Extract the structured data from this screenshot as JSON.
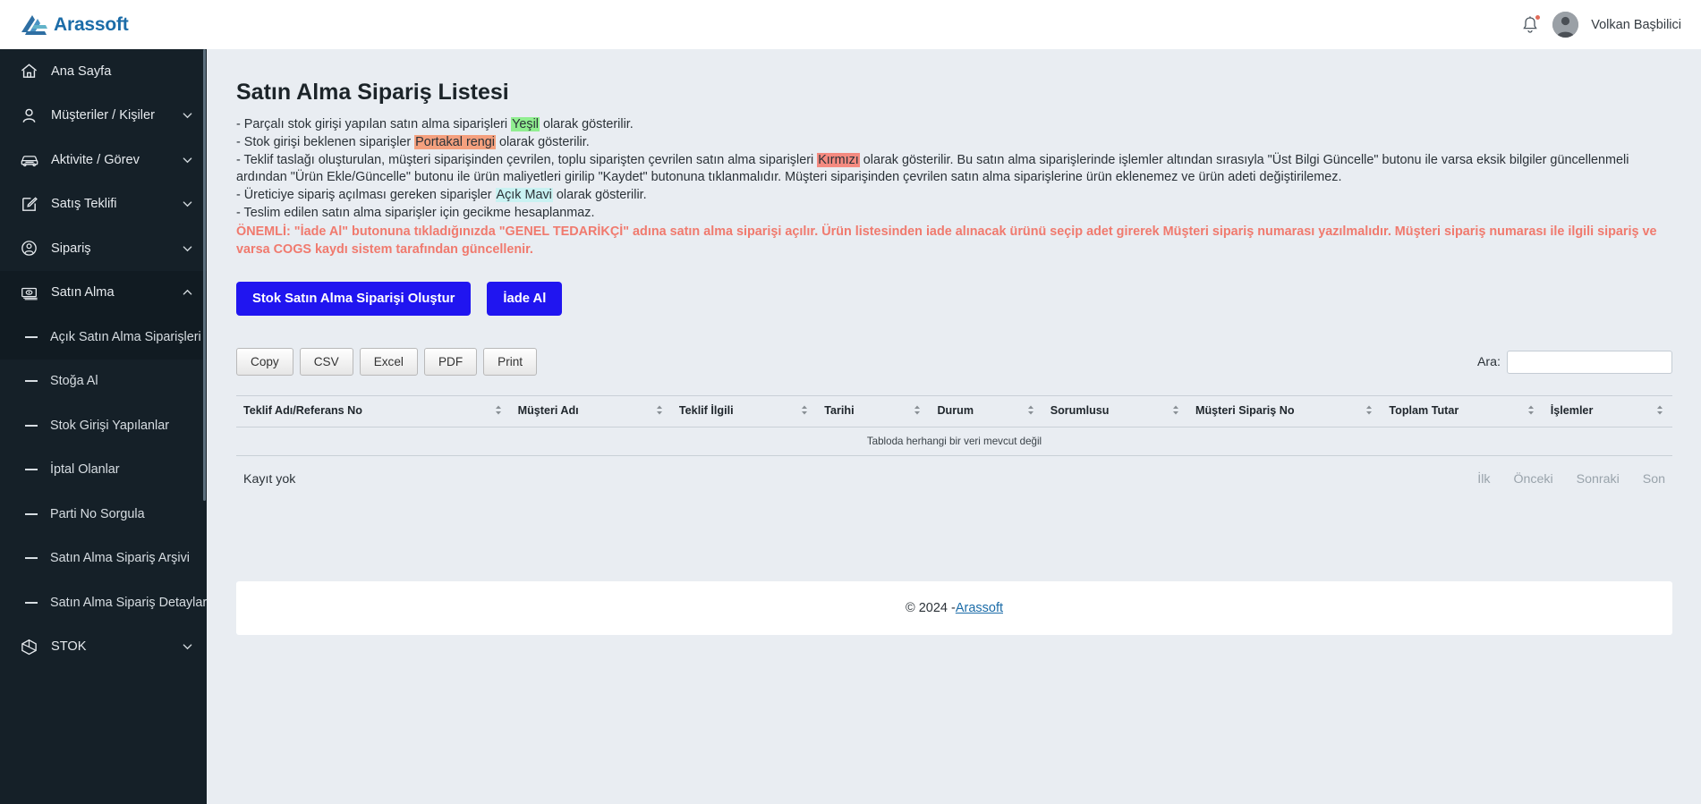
{
  "topbar": {
    "brand": "Arassoft",
    "user_name": "Volkan Başbilici",
    "bell_icon": "notification-bell-icon",
    "avatar_icon": "user-avatar-icon"
  },
  "sidebar": {
    "items": [
      {
        "label": "Ana Sayfa",
        "icon": "home-icon",
        "expandable": false,
        "active": false
      },
      {
        "label": "Müşteriler / Kişiler",
        "icon": "user-icon",
        "expandable": true,
        "active": false
      },
      {
        "label": "Aktivite / Görev",
        "icon": "car-icon",
        "expandable": true,
        "active": false
      },
      {
        "label": "Satış Teklifi",
        "icon": "edit-document-icon",
        "expandable": true,
        "active": false
      },
      {
        "label": "Sipariş",
        "icon": "user-circle-icon",
        "expandable": true,
        "active": false
      },
      {
        "label": "Satın Alma",
        "icon": "money-icon",
        "expandable": true,
        "active": true
      }
    ],
    "subitems": [
      {
        "label": "Açık Satın Alma Siparişleri",
        "active": true
      },
      {
        "label": "Stoğa Al",
        "active": false
      },
      {
        "label": "Stok Girişi Yapılanlar",
        "active": false
      },
      {
        "label": "İptal Olanlar",
        "active": false
      },
      {
        "label": "Parti No Sorgula",
        "active": false
      },
      {
        "label": "Satın Alma Sipariş Arşivi",
        "active": false
      },
      {
        "label": "Satın Alma Sipariş Detayları",
        "active": false
      }
    ],
    "bottom_items": [
      {
        "label": "STOK",
        "icon": "cube-icon",
        "expandable": true,
        "active": false
      }
    ]
  },
  "page": {
    "title": "Satın Alma Sipariş Listesi",
    "lines": {
      "l1_a": "- Parçalı stok girişi yapılan satın alma siparişleri ",
      "l1_hl": "Yeşil",
      "l1_b": " olarak gösterilir.",
      "l2_a": "- Stok girişi beklenen siparişler ",
      "l2_hl": "Portakal rengi",
      "l2_b": " olarak gösterilir.",
      "l3_a": "- Teklif taslağı oluşturulan, müşteri siparişinden çevrilen, toplu siparişten çevrilen satın alma siparişleri ",
      "l3_hl": "Kırmızı",
      "l3_b": " olarak gösterilir. Bu satın alma siparişlerinde işlemler altından sırasıyla \"Üst Bilgi Güncelle\" butonu ile varsa eksik bilgiler güncellenmeli ardından \"Ürün Ekle/Güncelle\" butonu ile ürün maliyetleri girilip \"Kaydet\" butonuna tıklanmalıdır. Müşteri siparişinden çevrilen satın alma siparişlerine ürün eklenemez ve ürün adeti değiştirilemez.",
      "l4_a": "- Üreticiye sipariş açılması gereken siparişler ",
      "l4_hl": "Açık Mavi",
      "l4_b": " olarak gösterilir.",
      "l5": "- Teslim edilen satın alma siparişler için gecikme hesaplanmaz.",
      "warning": "ÖNEMLİ: \"İade Al\" butonuna tıkladığınızda \"GENEL TEDARİKÇİ\" adına satın alma siparişi açılır. Ürün listesinden iade alınacak ürünü seçip adet girerek Müşteri sipariş numarası yazılmalıdır. Müşteri sipariş numarası ile ilgili sipariş ve varsa COGS kaydı sistem tarafından güncellenir."
    },
    "actions": {
      "create_order": "Stok Satın Alma Siparişi Oluştur",
      "return": "İade Al"
    }
  },
  "datatable": {
    "export_buttons": [
      "Copy",
      "CSV",
      "Excel",
      "PDF",
      "Print"
    ],
    "search_label": "Ara:",
    "search_value": "",
    "search_placeholder": "",
    "columns": [
      "Teklif Adı/Referans No",
      "Müşteri Adı",
      "Teklif İlgili",
      "Tarihi",
      "Durum",
      "Sorumlusu",
      "Müşteri Sipariş No",
      "Toplam Tutar",
      "İşlemler"
    ],
    "rows": [],
    "empty_message": "Tabloda herhangi bir veri mevcut değil",
    "info": "Kayıt yok",
    "pager": [
      "İlk",
      "Önceki",
      "Sonraki",
      "Son"
    ]
  },
  "footer": {
    "copyright": "© 2024 - ",
    "link": "Arassoft"
  },
  "colors": {
    "sidebar_bg": "#152028",
    "sidebar_active": "#111b22",
    "primary_button": "#2015f0",
    "brand": "#1b6ca8",
    "warning_red": "#f07a6e",
    "highlight_green": "#90ee90",
    "highlight_orange": "#f4a07e",
    "highlight_red": "#f48a80",
    "highlight_blue": "#c9f2f2",
    "page_bg": "#e9edf2"
  }
}
